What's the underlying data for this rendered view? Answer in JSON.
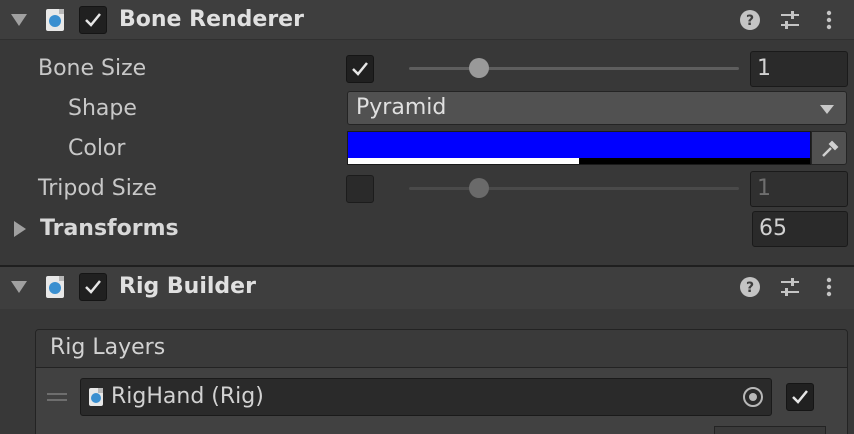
{
  "bone_renderer": {
    "title": "Bone Renderer",
    "enabled": true,
    "bone_size": {
      "label": "Bone Size",
      "enabled": true,
      "slider_fraction": 0.2,
      "value": "1"
    },
    "shape": {
      "label": "Shape",
      "value": "Pyramid"
    },
    "color": {
      "label": "Color",
      "hex": "#0000ff",
      "alpha_fraction": 0.5
    },
    "tripod_size": {
      "label": "Tripod Size",
      "enabled": false,
      "slider_fraction": 0.2,
      "value": "1"
    },
    "transforms": {
      "label": "Transforms",
      "count": "65"
    }
  },
  "rig_builder": {
    "title": "Rig Builder",
    "enabled": true,
    "rig_layers": {
      "header": "Rig Layers",
      "items": [
        {
          "label": "RigHand (Rig)",
          "active": true
        }
      ]
    }
  },
  "icons": {
    "help": "help-icon",
    "presets": "presets-icon",
    "menu": "kebab-menu-icon",
    "script": "script-icon",
    "eyedropper": "eyedropper-icon",
    "object_picker": "object-picker-icon"
  },
  "colors": {
    "background": "#383838",
    "header": "#3e3e3e",
    "accent_blue": "#0000ff"
  }
}
